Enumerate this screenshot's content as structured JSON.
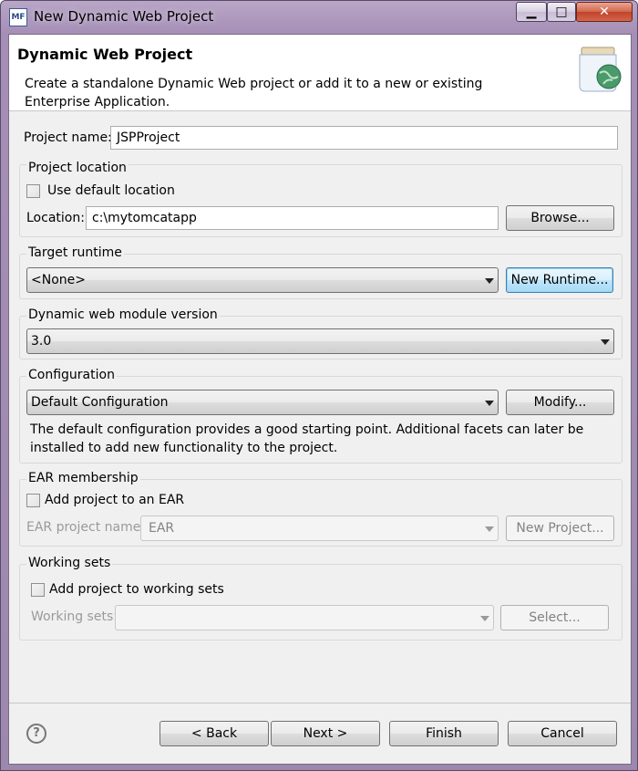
{
  "window": {
    "title": "New Dynamic Web Project",
    "app_icon_text": "MF",
    "close_glyph": "✕",
    "min_glyph": "▁",
    "max_glyph": "□"
  },
  "header": {
    "title": "Dynamic Web Project",
    "description": "Create a standalone Dynamic Web project or add it to a new or existing Enterprise Application."
  },
  "project_name": {
    "label": "Project name:",
    "value": "JSPProject"
  },
  "project_location": {
    "group_label": "Project location",
    "use_default_label": "Use default location",
    "use_default_checked": false,
    "location_label": "Location:",
    "location_value": "c:\\mytomcatapp",
    "browse_label": "Browse..."
  },
  "target_runtime": {
    "group_label": "Target runtime",
    "selected": "<None>",
    "new_runtime_label": "New Runtime..."
  },
  "module_version": {
    "group_label": "Dynamic web module version",
    "selected": "3.0"
  },
  "configuration": {
    "group_label": "Configuration",
    "selected": "Default Configuration",
    "modify_label": "Modify...",
    "description": "The default configuration provides a good starting point. Additional facets can later be installed to add new functionality to the project."
  },
  "ear": {
    "group_label": "EAR membership",
    "add_label": "Add project to an EAR",
    "add_checked": false,
    "project_name_label": "EAR project name:",
    "project_name_value": "EAR",
    "new_project_label": "New Project..."
  },
  "working_sets": {
    "group_label": "Working sets",
    "add_label": "Add project to working sets",
    "add_checked": false,
    "sets_label": "Working sets:",
    "sets_value": "",
    "select_label": "Select..."
  },
  "footer": {
    "help_glyph": "?",
    "back_label": "< Back",
    "next_label": "Next >",
    "finish_label": "Finish",
    "cancel_label": "Cancel"
  }
}
